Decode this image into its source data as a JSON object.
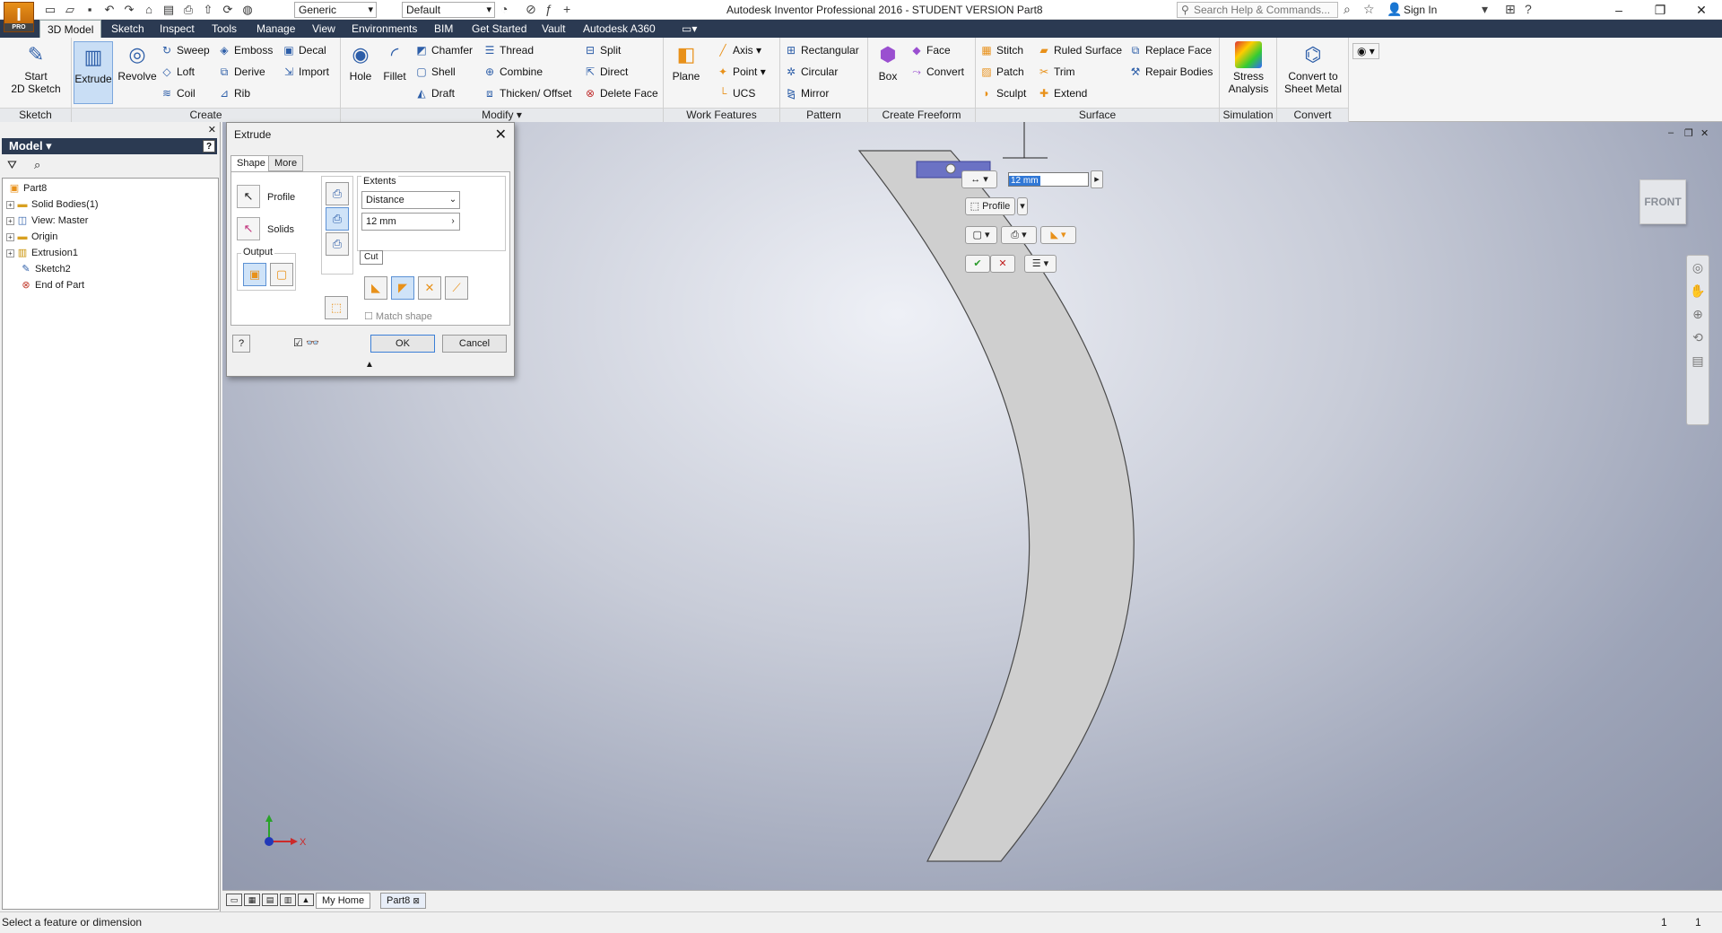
{
  "titlebar": {
    "logo": "I",
    "logo_sub": "PRO",
    "material": "Generic",
    "appearance": "Default",
    "title": "Autodesk Inventor Professional 2016 - STUDENT VERSION    Part8",
    "search_placeholder": "Search Help & Commands...",
    "sign_in": "Sign In"
  },
  "tabs": [
    "3D Model",
    "Sketch",
    "Inspect",
    "Tools",
    "Manage",
    "View",
    "Environments",
    "BIM",
    "Get Started",
    "Vault",
    "Autodesk A360"
  ],
  "ribbon": {
    "sketch": {
      "label": "Sketch",
      "start": "Start\n2D Sketch"
    },
    "create": {
      "label": "Create",
      "extrude": "Extrude",
      "revolve": "Revolve",
      "sweep": "Sweep",
      "loft": "Loft",
      "coil": "Coil",
      "emboss": "Emboss",
      "derive": "Derive",
      "rib": "Rib",
      "decal": "Decal",
      "import": "Import"
    },
    "modify": {
      "label": "Modify ▾",
      "hole": "Hole",
      "fillet": "Fillet",
      "chamfer": "Chamfer",
      "shell": "Shell",
      "draft": "Draft",
      "thread": "Thread",
      "combine": "Combine",
      "thicken": "Thicken/ Offset",
      "split": "Split",
      "direct": "Direct",
      "delete_face": "Delete Face"
    },
    "work": {
      "label": "Work Features",
      "plane": "Plane",
      "axis": "Axis",
      "point": "Point",
      "ucs": "UCS"
    },
    "pattern": {
      "label": "Pattern",
      "rectangular": "Rectangular",
      "circular": "Circular",
      "mirror": "Mirror"
    },
    "freeform": {
      "label": "Create Freeform",
      "box": "Box",
      "face": "Face",
      "convert": "Convert"
    },
    "surface": {
      "label": "Surface",
      "stitch": "Stitch",
      "patch": "Patch",
      "sculpt": "Sculpt",
      "ruled": "Ruled Surface",
      "trim": "Trim",
      "extend": "Extend",
      "replace": "Replace Face",
      "repair": "Repair Bodies"
    },
    "simulation": {
      "label": "Simulation",
      "stress": "Stress\nAnalysis"
    },
    "convert": {
      "label": "Convert",
      "sheet": "Convert to\nSheet Metal"
    }
  },
  "browser": {
    "title": "Model ▾",
    "tree": [
      {
        "label": "Part8",
        "expand": ""
      },
      {
        "label": "Solid Bodies(1)",
        "expand": "+"
      },
      {
        "label": "View: Master",
        "expand": "+"
      },
      {
        "label": "Origin",
        "expand": "+"
      },
      {
        "label": "Extrusion1",
        "expand": "+"
      },
      {
        "label": "Sketch2",
        "expand": ""
      },
      {
        "label": "End of Part",
        "expand": ""
      }
    ]
  },
  "dialog": {
    "title": "Extrude",
    "tab_shape": "Shape",
    "tab_more": "More",
    "profile": "Profile",
    "solids": "Solids",
    "output": "Output",
    "extents": "Extents",
    "extents_value": "Distance",
    "distance": "12 mm",
    "match_shape": "Match shape",
    "ok": "OK",
    "cancel": "Cancel",
    "tooltip": "Cut"
  },
  "minitoolbar": {
    "distance": "12 mm",
    "profile": "Profile"
  },
  "viewcube": "FRONT",
  "triad": {
    "x": "X"
  },
  "doctabs": [
    "My Home",
    "Part8"
  ],
  "status": {
    "text": "Select a feature or dimension",
    "count1": "1",
    "count2": "1"
  }
}
